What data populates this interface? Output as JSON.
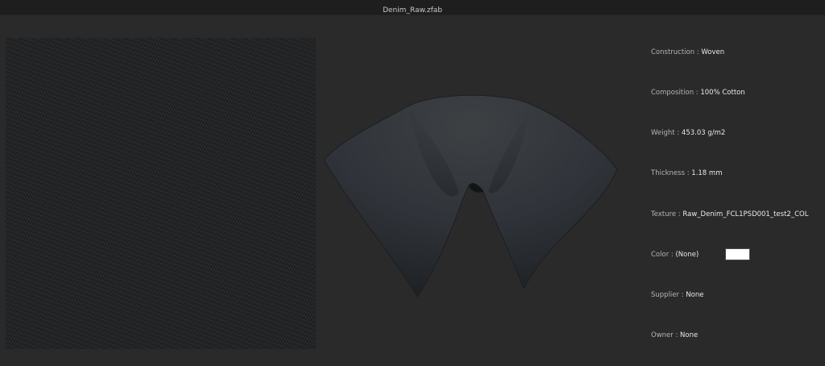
{
  "window": {
    "title": "Denim_Raw.zfab"
  },
  "fabric_info": {
    "construction_label": "Construction :",
    "construction_value": "Woven",
    "composition_label": "Composition :",
    "composition_value": "100% Cotton",
    "weight_label": "Weight :",
    "weight_value": "453.03 g/m2",
    "thickness_label": "Thickness :",
    "thickness_value": "1.18 mm",
    "texture_label": "Texture :",
    "texture_value": "Raw_Denim_FCL1PSD001_test2_COL",
    "color_label": "Color :",
    "color_value": "(None)",
    "color_swatch": "#ffffff",
    "supplier_label": "Supplier :",
    "supplier_value": "None",
    "owner_label": "Owner :",
    "owner_value": "None"
  },
  "colors": {
    "background": "#2a2a2a",
    "titlebar": "#1e1e1e",
    "fabric": "#3a3e41"
  }
}
